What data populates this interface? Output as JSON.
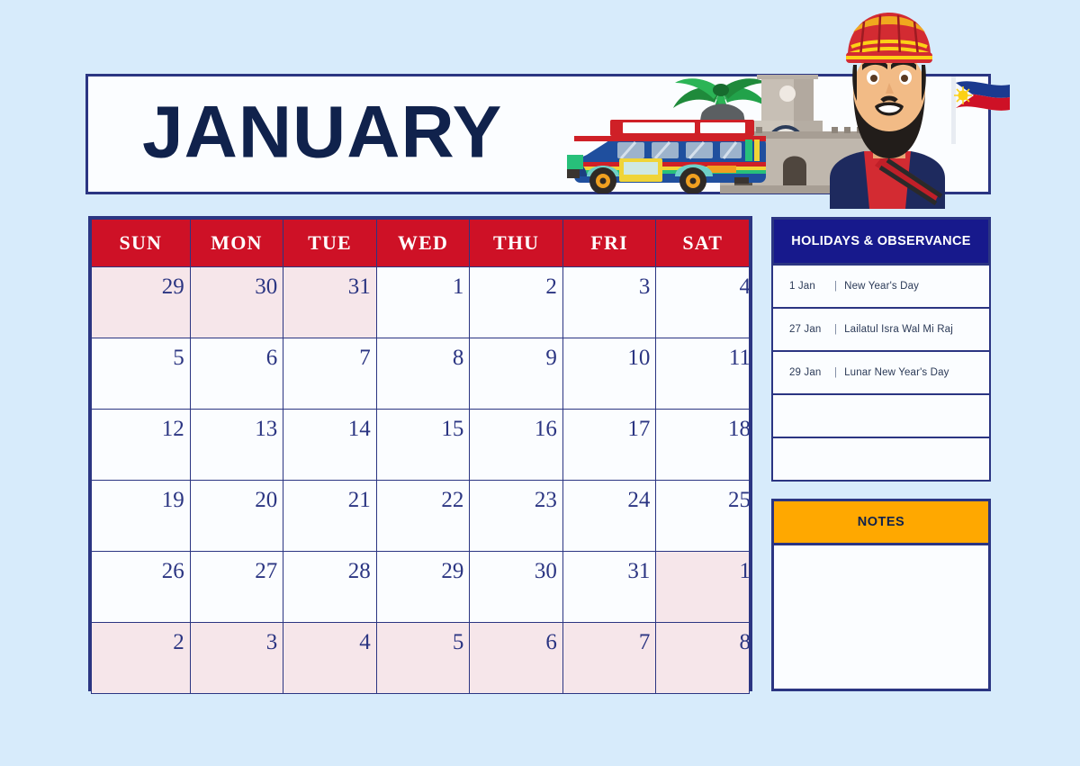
{
  "page": {
    "background_color": "#D7EBFB",
    "accent_navy": "#2B3582",
    "accent_red": "#CE1126",
    "accent_deep_blue": "#17198C",
    "accent_orange": "#FFA800",
    "out_of_month_cell_color": "#F6E6EA",
    "title_text_color": "#10224C"
  },
  "header": {
    "month_title": "JANUARY"
  },
  "illustration": {
    "alt": "Philippines themed header illustration",
    "elements": [
      "palm-tree-icon",
      "jeepney-icon",
      "cathedral-icon",
      "filipino-man-icon",
      "philippine-flag-icon"
    ]
  },
  "calendar": {
    "weekday_headers": [
      "SUN",
      "MON",
      "TUE",
      "WED",
      "THU",
      "FRI",
      "SAT"
    ],
    "weeks": [
      [
        {
          "day": "29",
          "out": true
        },
        {
          "day": "30",
          "out": true
        },
        {
          "day": "31",
          "out": true
        },
        {
          "day": "1",
          "out": false
        },
        {
          "day": "2",
          "out": false
        },
        {
          "day": "3",
          "out": false
        },
        {
          "day": "4",
          "out": false
        }
      ],
      [
        {
          "day": "5",
          "out": false
        },
        {
          "day": "6",
          "out": false
        },
        {
          "day": "7",
          "out": false
        },
        {
          "day": "8",
          "out": false
        },
        {
          "day": "9",
          "out": false
        },
        {
          "day": "10",
          "out": false
        },
        {
          "day": "11",
          "out": false
        }
      ],
      [
        {
          "day": "12",
          "out": false
        },
        {
          "day": "13",
          "out": false
        },
        {
          "day": "14",
          "out": false
        },
        {
          "day": "15",
          "out": false
        },
        {
          "day": "16",
          "out": false
        },
        {
          "day": "17",
          "out": false
        },
        {
          "day": "18",
          "out": false
        }
      ],
      [
        {
          "day": "19",
          "out": false
        },
        {
          "day": "20",
          "out": false
        },
        {
          "day": "21",
          "out": false
        },
        {
          "day": "22",
          "out": false
        },
        {
          "day": "23",
          "out": false
        },
        {
          "day": "24",
          "out": false
        },
        {
          "day": "25",
          "out": false
        }
      ],
      [
        {
          "day": "26",
          "out": false
        },
        {
          "day": "27",
          "out": false
        },
        {
          "day": "28",
          "out": false
        },
        {
          "day": "29",
          "out": false
        },
        {
          "day": "30",
          "out": false
        },
        {
          "day": "31",
          "out": false
        },
        {
          "day": "1",
          "out": true
        }
      ],
      [
        {
          "day": "2",
          "out": true
        },
        {
          "day": "3",
          "out": true
        },
        {
          "day": "4",
          "out": true
        },
        {
          "day": "5",
          "out": true
        },
        {
          "day": "6",
          "out": true
        },
        {
          "day": "7",
          "out": true
        },
        {
          "day": "8",
          "out": true
        }
      ]
    ]
  },
  "holidays": {
    "title": "HOLIDAYS &  OBSERVANCE",
    "separator": "|",
    "items": [
      {
        "date": "1 Jan",
        "name": "New Year's Day"
      },
      {
        "date": "27 Jan",
        "name": "Lailatul Isra Wal Mi Raj"
      },
      {
        "date": "29 Jan",
        "name": "Lunar New Year's Day"
      },
      {
        "date": "",
        "name": ""
      },
      {
        "date": "",
        "name": ""
      }
    ]
  },
  "notes": {
    "title": "NOTES",
    "content": ""
  }
}
